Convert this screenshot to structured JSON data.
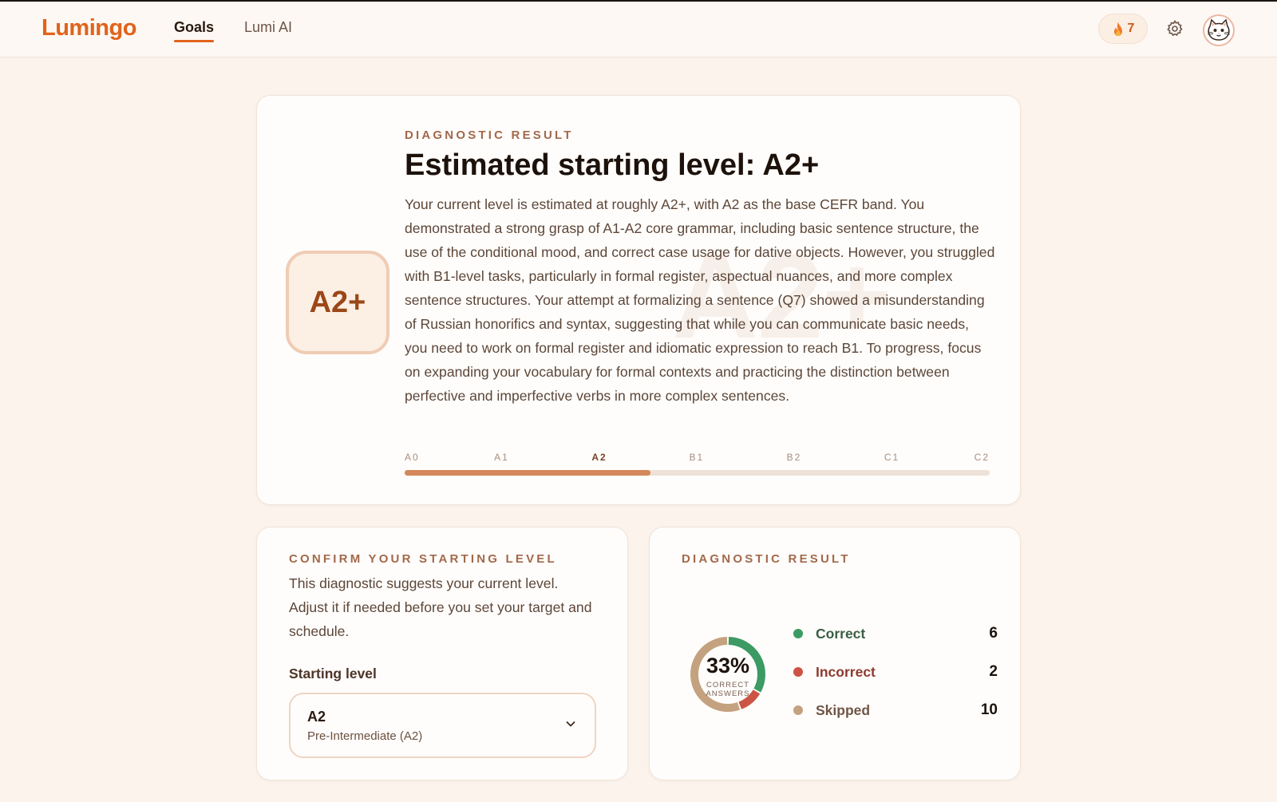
{
  "header": {
    "logo": "Lumingo",
    "nav": [
      {
        "label": "Goals",
        "active": true
      },
      {
        "label": "Lumi AI",
        "active": false
      }
    ],
    "streak_count": "7",
    "icons": {
      "streak": "flame-icon",
      "settings": "gear-icon",
      "avatar": "cat-avatar"
    }
  },
  "diagnostic": {
    "eyebrow": "DIAGNOSTIC RESULT",
    "title": "Estimated starting level: A2+",
    "badge": "A2+",
    "watermark": "A2+",
    "description": "Your current level is estimated at roughly A2+, with A2 as the base CEFR band. You demonstrated a strong grasp of A1-A2 core grammar, including basic sentence structure, the use of the conditional mood, and correct case usage for dative objects. However, you struggled with B1-level tasks, particularly in formal register, aspectual nuances, and more complex sentence structures. Your attempt at formalizing a sentence (Q7) showed a misunderstanding of Russian honorifics and syntax, suggesting that while you can communicate basic needs, you need to work on formal register and idiomatic expression to reach B1. To progress, focus on expanding your vocabulary for formal contexts and practicing the distinction between perfective and imperfective verbs in more complex sentences.",
    "scale": {
      "levels": [
        "A0",
        "A1",
        "A2",
        "B1",
        "B2",
        "C1",
        "C2"
      ],
      "current": "A2",
      "progress_fraction": 0.42
    }
  },
  "confirm": {
    "eyebrow": "CONFIRM YOUR STARTING LEVEL",
    "description": "This diagnostic suggests your current level. Adjust it if needed before you set your target and schedule.",
    "field_label": "Starting level",
    "select_value": "A2",
    "select_sub": "Pre-Intermediate (A2)"
  },
  "result": {
    "eyebrow": "DIAGNOSTIC RESULT",
    "percent": "33%",
    "percent_caption": "CORRECT ANSWERS",
    "stats": [
      {
        "label": "Correct",
        "count": 6,
        "color": "#3c9a63"
      },
      {
        "label": "Incorrect",
        "count": 2,
        "color": "#cc5444"
      },
      {
        "label": "Skipped",
        "count": 10,
        "color": "#c4a27f"
      }
    ]
  },
  "colors": {
    "accent": "#e0631b",
    "badge_text": "#9b4717",
    "progress_fill": "#d4875a",
    "background": "#fbf3ec"
  }
}
